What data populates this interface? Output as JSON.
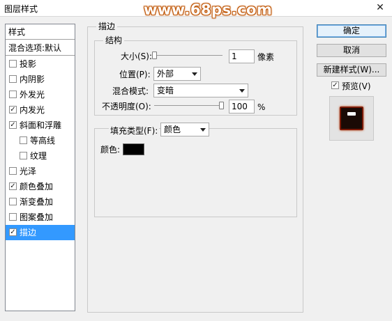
{
  "window": {
    "title": "图层样式",
    "watermark": "www.68ps.com",
    "close_glyph": "✕"
  },
  "styles_list": {
    "header": "样式",
    "blend_default": "混合选项:默认",
    "items": [
      {
        "label": "投影",
        "checked": false
      },
      {
        "label": "内阴影",
        "checked": false
      },
      {
        "label": "外发光",
        "checked": false
      },
      {
        "label": "内发光",
        "checked": true
      },
      {
        "label": "斜面和浮雕",
        "checked": true
      },
      {
        "label": "等高线",
        "checked": false
      },
      {
        "label": "纹理",
        "checked": false
      },
      {
        "label": "光泽",
        "checked": false
      },
      {
        "label": "颜色叠加",
        "checked": true
      },
      {
        "label": "渐变叠加",
        "checked": false
      },
      {
        "label": "图案叠加",
        "checked": false
      },
      {
        "label": "描边",
        "checked": true,
        "selected": true
      }
    ]
  },
  "stroke": {
    "section_title": "描边",
    "structure_title": "结构",
    "size_label": "大小(S):",
    "size_value": "1",
    "size_unit": "像素",
    "position_label": "位置(P):",
    "position_value": "外部",
    "blend_label": "混合模式:",
    "blend_value": "变暗",
    "opacity_label": "不透明度(O):",
    "opacity_value": "100",
    "opacity_unit": "%",
    "opacity_fraction": 1.0,
    "size_fraction": 0.0,
    "fill_type_label": "填充类型(F):",
    "fill_type_value": "颜色",
    "color_label": "颜色:",
    "color_value": "#000000"
  },
  "buttons": {
    "ok": "确定",
    "cancel": "取消",
    "new_style": "新建样式(W)...",
    "preview_label": "预览(V)",
    "preview_checked": true
  },
  "check_glyph": "✓"
}
